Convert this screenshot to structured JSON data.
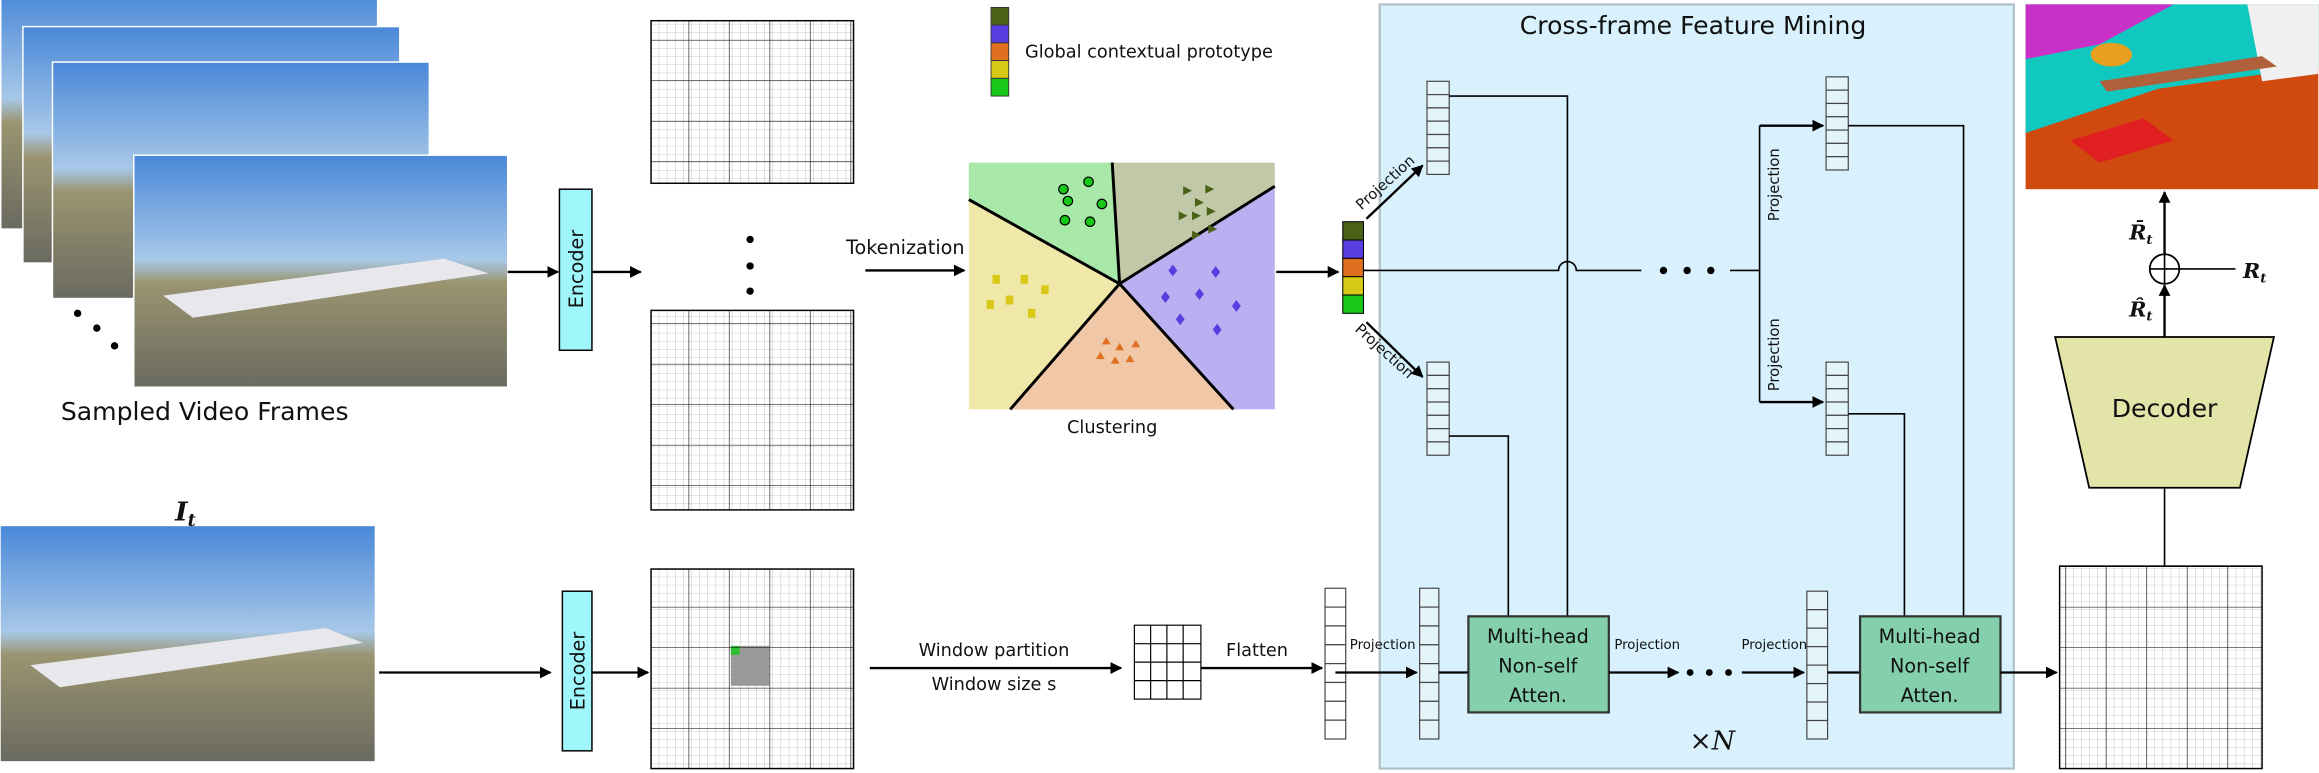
{
  "labels": {
    "sampled_frames": "Sampled Video Frames",
    "current_frame": "I",
    "current_frame_sub": "t",
    "encoder_top": "Encoder",
    "encoder_bottom": "Encoder",
    "tokenization": "Tokenization",
    "clustering": "Clustering",
    "legend": "Global contextual prototype",
    "panel_title": "Cross-frame Feature Mining",
    "projection": "Projection",
    "window_partition": "Window partition",
    "window_size": "Window size s",
    "flatten": "Flatten",
    "mh_line1": "Multi-head",
    "mh_line2": "Non-self",
    "mh_line3": "Atten.",
    "repeat": "×N",
    "decoder": "Decoder",
    "r_hat": "R̂",
    "r_bar": "R̄",
    "r": "R",
    "sub_t": "t"
  },
  "colors": {
    "prototype": [
      "#4a6118",
      "#5a3de0",
      "#e07020",
      "#d8c818",
      "#18c818"
    ],
    "encoder": "#9ff7fb",
    "panel": "#d8f1fc",
    "attention": "#84cfac",
    "decoder": "#e2e4a8",
    "cluster_regions": [
      "#a8e8a8",
      "#c0c8a8",
      "#b8b0f0",
      "#f0c8a8",
      "#f0e8a8"
    ]
  }
}
